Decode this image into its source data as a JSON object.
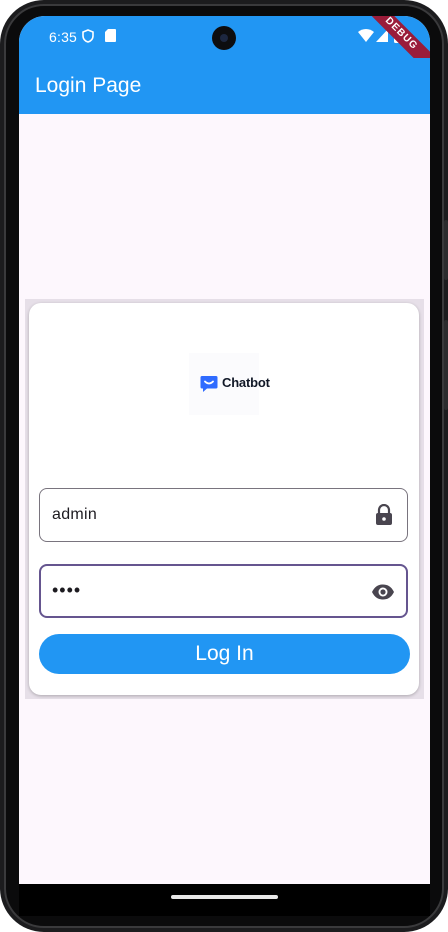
{
  "status_bar": {
    "time": "6:35",
    "icons_left": [
      "shield-icon",
      "sd-card-icon"
    ],
    "icons_right": [
      "wifi-icon",
      "signal-icon",
      "battery-icon"
    ],
    "debug_banner": "DEBUG"
  },
  "app_bar": {
    "title": "Login Page"
  },
  "login_card": {
    "logo_text": "Chatbot",
    "username": {
      "value": "admin",
      "icon": "lock-icon"
    },
    "password": {
      "value": "••••",
      "icon": "eye-icon"
    },
    "login_button_label": "Log In"
  },
  "colors": {
    "primary": "#2196f3",
    "screen_background": "#fdf7fd",
    "focused_border": "#65558f",
    "debug_ribbon": "#9a1c3a"
  }
}
